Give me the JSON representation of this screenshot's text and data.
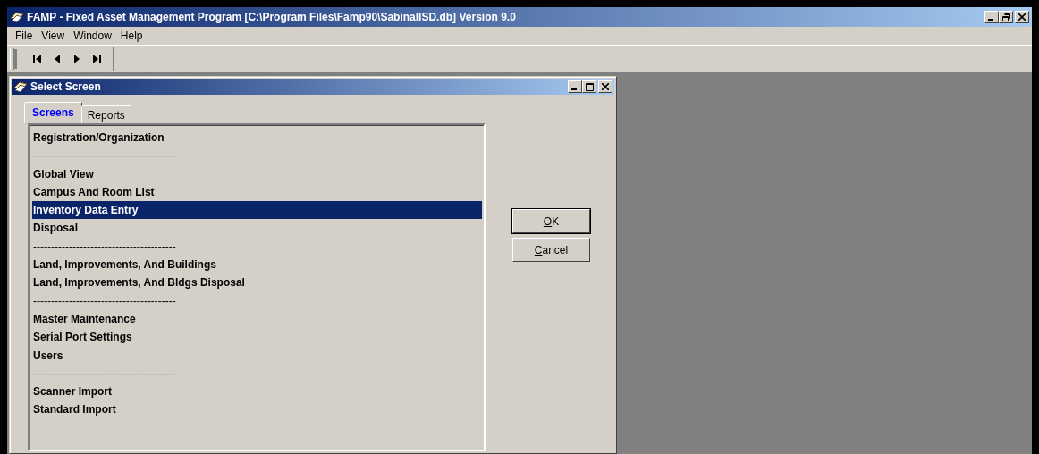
{
  "window": {
    "title": "FAMP - Fixed Asset Management Program [C:\\Program Files\\Famp90\\SabinalISD.db] Version 9.0"
  },
  "menu": [
    "File",
    "View",
    "Window",
    "Help"
  ],
  "toolbar": [
    {
      "kind": "first"
    },
    {
      "kind": "prev"
    },
    {
      "kind": "next"
    },
    {
      "kind": "last"
    }
  ],
  "dialog": {
    "title": "Select Screen",
    "tabs": [
      {
        "label": "Screens",
        "selected": true
      },
      {
        "label": "Reports",
        "selected": false
      }
    ],
    "items": [
      {
        "kind": "item",
        "label": "Registration/Organization",
        "selected": false
      },
      {
        "kind": "separator",
        "label": "----------------------------------------",
        "selected": false
      },
      {
        "kind": "item",
        "label": "Global View",
        "selected": false
      },
      {
        "kind": "item",
        "label": "Campus And Room List",
        "selected": false
      },
      {
        "kind": "item",
        "label": "Inventory Data Entry",
        "selected": true
      },
      {
        "kind": "item",
        "label": "Disposal",
        "selected": false
      },
      {
        "kind": "separator",
        "label": "----------------------------------------",
        "selected": false
      },
      {
        "kind": "item",
        "label": "Land, Improvements, And Buildings",
        "selected": false
      },
      {
        "kind": "item",
        "label": "Land, Improvements, And Bldgs Disposal",
        "selected": false
      },
      {
        "kind": "separator",
        "label": "----------------------------------------",
        "selected": false
      },
      {
        "kind": "item",
        "label": "Master Maintenance",
        "selected": false
      },
      {
        "kind": "item",
        "label": "Serial Port Settings",
        "selected": false
      },
      {
        "kind": "item",
        "label": "Users",
        "selected": false
      },
      {
        "kind": "separator",
        "label": "----------------------------------------",
        "selected": false
      },
      {
        "kind": "item",
        "label": "Scanner Import",
        "selected": false
      },
      {
        "kind": "item",
        "label": "Standard Import",
        "selected": false
      }
    ],
    "buttons": [
      {
        "label": "OK",
        "default": true,
        "mnemonic_first": true
      },
      {
        "label": "Cancel",
        "default": false,
        "mnemonic_first": true
      }
    ]
  }
}
